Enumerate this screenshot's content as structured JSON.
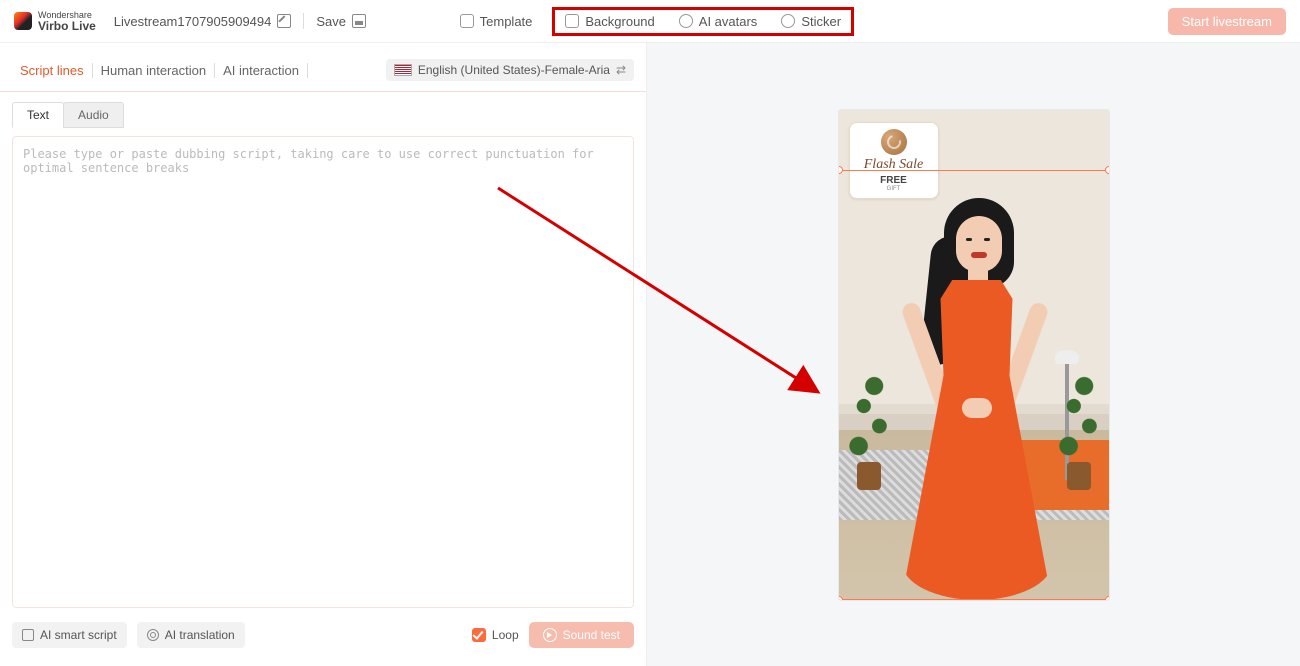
{
  "brand": {
    "top": "Wondershare",
    "name": "Virbo Live"
  },
  "header": {
    "project_name": "Livestream1707905909494",
    "save_label": "Save",
    "template_label": "Template",
    "background_label": "Background",
    "avatars_label": "AI avatars",
    "sticker_label": "Sticker",
    "start_label": "Start livestream"
  },
  "section_tabs": {
    "script_lines": "Script lines",
    "human_interaction": "Human interaction",
    "ai_interaction": "AI interaction"
  },
  "voice": {
    "label": "English (United States)-Female-Aria"
  },
  "subtabs": {
    "text": "Text",
    "audio": "Audio"
  },
  "script": {
    "placeholder": "Please type or paste dubbing script, taking care to use correct punctuation for optimal sentence breaks"
  },
  "footer": {
    "ai_smart_script": "AI smart script",
    "ai_translation": "AI translation",
    "loop_label": "Loop",
    "sound_test": "Sound test"
  },
  "sticker": {
    "title": "Flash Sale",
    "line1": "FREE",
    "line2": "GIFT"
  },
  "annotation": {
    "highlight_targets": [
      "Background",
      "AI avatars",
      "Sticker"
    ]
  }
}
